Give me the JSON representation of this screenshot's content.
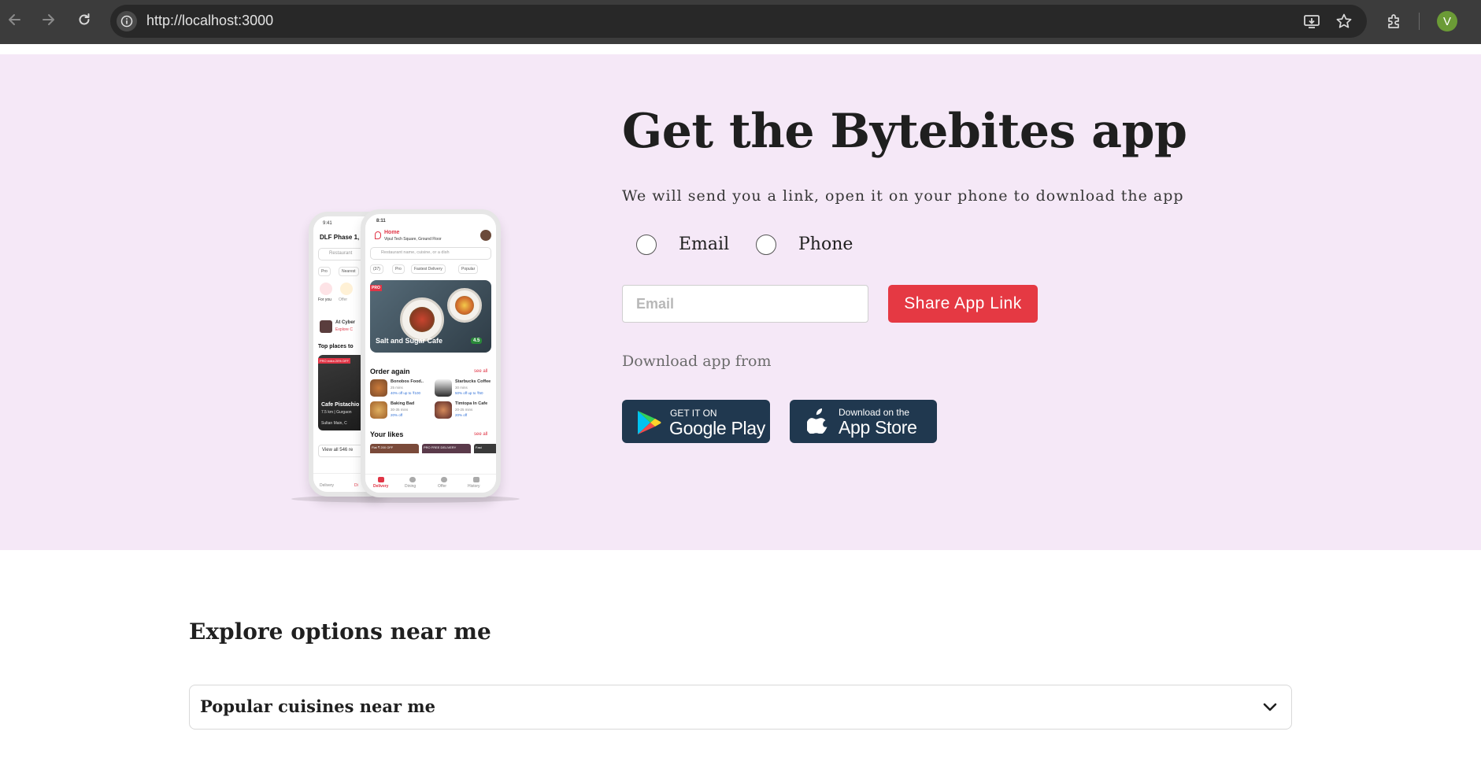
{
  "browser": {
    "url": "http://localhost:3000",
    "profile_initial": "V",
    "icons": [
      "back-icon",
      "forward-icon",
      "reload-icon",
      "site-info-icon",
      "install-app-icon",
      "bookmark-star-icon",
      "extensions-icon"
    ]
  },
  "hero": {
    "title": "Get the Bytebites app",
    "subtitle": "We will send you a link, open it on your phone to download the app",
    "radio_email_label": "Email",
    "radio_phone_label": "Phone",
    "email_placeholder": "Email",
    "share_button_label": "Share App Link",
    "download_from_label": "Download app from",
    "google_play": {
      "small": "GET IT ON",
      "big": "Google Play"
    },
    "app_store": {
      "small": "Download on the",
      "big": "App Store"
    },
    "background_color": "#f5e8f7",
    "accent_color": "#e53943"
  },
  "phone_mockup": {
    "back_phone": {
      "time": "9:41",
      "location": "DLF Phase 1,",
      "search": "Restaurant",
      "chips": [
        "Pro",
        "Nearest"
      ],
      "categories": [
        "For you",
        "Offer"
      ],
      "promo_title": "At Cyber",
      "promo_sub": "Explore C",
      "section": "Top places to",
      "card_badge": "PRO extra 20% OFF",
      "card_title": "Cafe Pistachio",
      "card_meta": "7.5 km | Gurgaon",
      "card_sub": "Sultan Main, C",
      "view_all": "View all 546 re",
      "nav": [
        "Delivery",
        "Di"
      ]
    },
    "front_phone": {
      "time": "8:11",
      "home_label": "Home",
      "address": "Vipul Tech Square, Ground Floor",
      "search": "Restaurant name, cuisine, or a dish",
      "chips": [
        "(37)",
        "Pro",
        "Fastest Delivery",
        "Popular"
      ],
      "featured_badge": "PRO",
      "featured_title": "Salt and Sugar Cafe",
      "featured_rating": "4.5",
      "order_again": "Order again",
      "see_all": "see all",
      "order_items": [
        {
          "name": "Bonobos Food..",
          "time": "25 mins",
          "offer": "40% off up to ₹100"
        },
        {
          "name": "Starbucks Coffee",
          "time": "30 mins",
          "offer": "50% off up to ₹50"
        },
        {
          "name": "Baking Bad",
          "time": "30-35 mins",
          "offer": "20% off"
        },
        {
          "name": "Timtopa In Cafe",
          "time": "20-25 mins",
          "offer": "20% off"
        }
      ],
      "your_likes": "Your likes",
      "likes_badges": [
        "Flat ₹ 200 OFF",
        "PRO FREE DELIVERY",
        "Fast"
      ],
      "nav": [
        "Delivery",
        "Dining",
        "Offer",
        "History"
      ]
    }
  },
  "explore": {
    "title": "Explore options near me",
    "accordion_title": "Popular cuisines near me"
  }
}
